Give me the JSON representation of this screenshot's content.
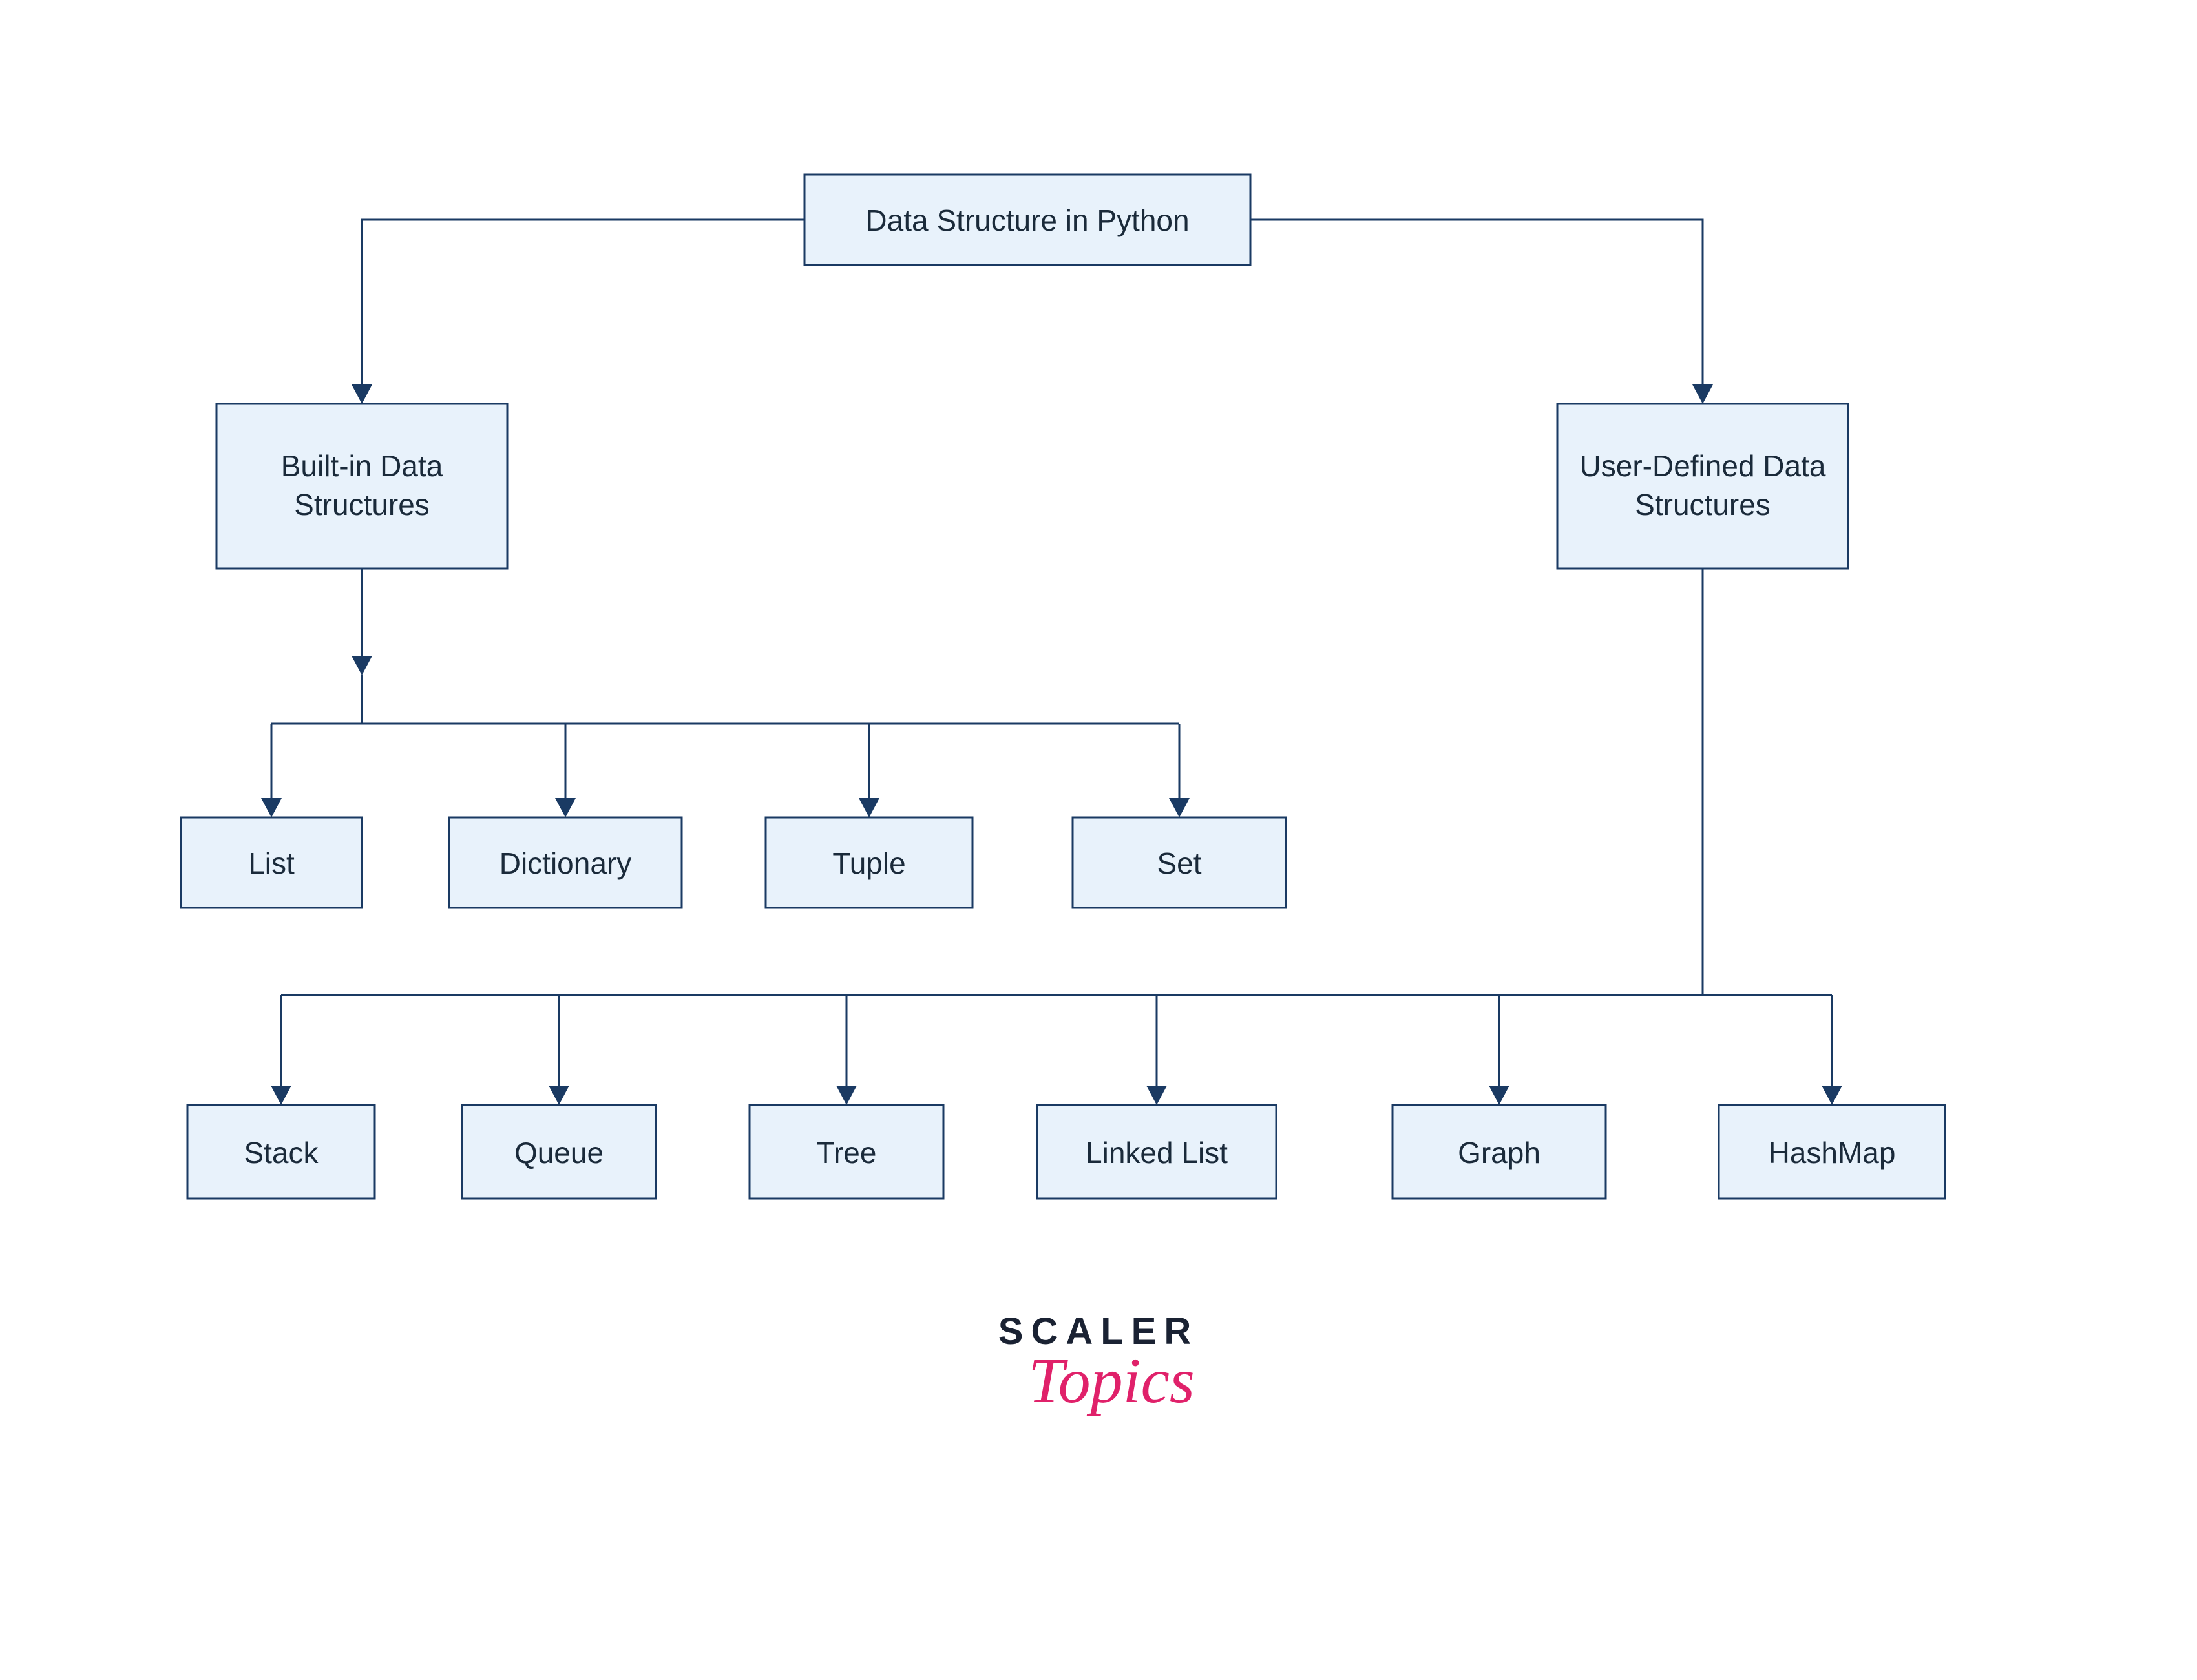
{
  "root": {
    "label": "Data Structure in Python"
  },
  "builtin": {
    "label": "Built-in Data\nStructures"
  },
  "userdef": {
    "label": "User-Defined Data\nStructures"
  },
  "builtin_children": [
    {
      "label": "List"
    },
    {
      "label": "Dictionary"
    },
    {
      "label": "Tuple"
    },
    {
      "label": "Set"
    }
  ],
  "userdef_children": [
    {
      "label": "Stack"
    },
    {
      "label": "Queue"
    },
    {
      "label": "Tree"
    },
    {
      "label": "Linked List"
    },
    {
      "label": "Graph"
    },
    {
      "label": "HashMap"
    }
  ],
  "logo": {
    "main": "SCALER",
    "script": "Topics"
  },
  "colors": {
    "node_fill": "#e8f2fb",
    "node_stroke": "#1a3a63",
    "logo_main": "#1a2233",
    "logo_script": "#e0216a"
  }
}
